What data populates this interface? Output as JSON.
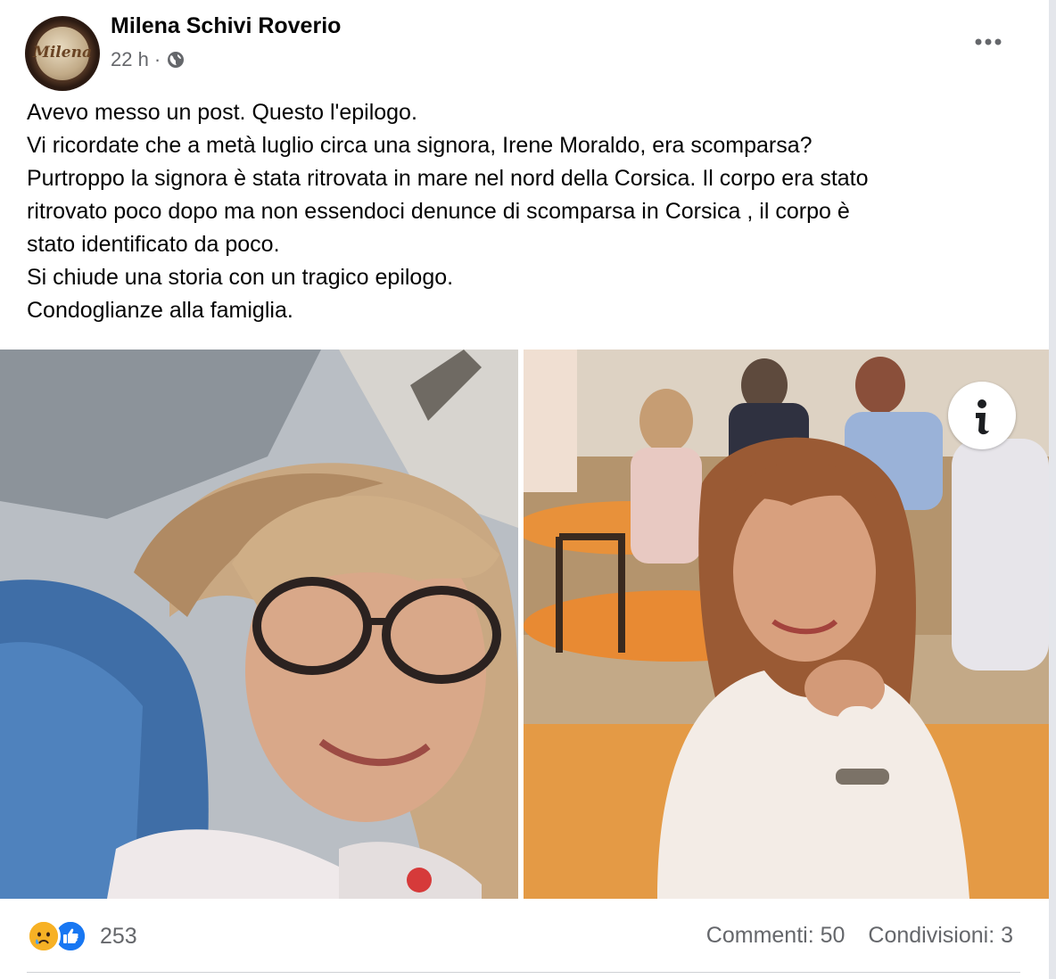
{
  "post": {
    "author": "Milena Schivi Roverio",
    "avatar_text": "Milena",
    "time": "22 h",
    "separator": "·",
    "privacy_icon": "globe-icon",
    "more_icon": "more-options-icon",
    "text_lines": [
      "Avevo messo un post. Questo l'epilogo.",
      "Vi ricordate che a metà luglio circa una signora, Irene Moraldo, era scomparsa?",
      "Purtroppo la signora è stata ritrovata in mare nel nord della Corsica. Il corpo era stato",
      "ritrovato poco dopo ma non essendoci denunce di scomparsa in Corsica , il corpo è",
      "stato identificato da poco.",
      "Si chiude una storia con un tragico epilogo.",
      "Condoglianze alla famiglia."
    ],
    "photos": [
      {
        "name": "photo-left",
        "description_icon": "portrait"
      },
      {
        "name": "photo-right",
        "description_icon": "portrait"
      }
    ],
    "info_icon": "info-icon"
  },
  "footer": {
    "reaction_icons": [
      "sad-icon",
      "like-icon"
    ],
    "reaction_count": "253",
    "comments": "Commenti: 50",
    "shares": "Condivisioni: 3"
  },
  "colors": {
    "secondary_text": "#65676b",
    "like_blue": "#1877f2",
    "sad_yellow": "#f7b125"
  }
}
